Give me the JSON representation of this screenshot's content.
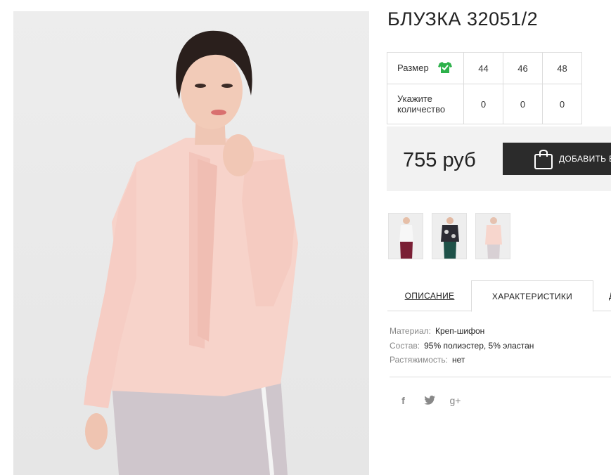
{
  "product": {
    "title": "БЛУЗКА 32051/2",
    "price": "755 руб",
    "add_to_cart_label": "ДОБАВИТЬ В КОРЗИНУ"
  },
  "sizes": {
    "size_label": "Размер",
    "size_icon": "shirt-check-icon",
    "qty_label": "Укажите количество",
    "columns": [
      "44",
      "46",
      "48"
    ],
    "quantities": [
      "0",
      "0",
      "0"
    ]
  },
  "thumbnails": [
    "thumb-white-blouse-burgundy-pants",
    "thumb-floral-blouse-green-pants",
    "thumb-pink-blouse"
  ],
  "tabs": [
    {
      "label": "ОПИСАНИЕ",
      "active": false
    },
    {
      "label": "ХАРАКТЕРИСТИКИ",
      "active": true
    },
    {
      "label": "Д",
      "active": false
    }
  ],
  "specs": [
    {
      "key": "Материал:",
      "value": "Креп-шифон"
    },
    {
      "key": "Состав:",
      "value": "95% полиэстер, 5% эластан"
    },
    {
      "key": "Растяжимость:",
      "value": "нет"
    }
  ],
  "share": {
    "facebook": "f",
    "twitter": "twitter-icon",
    "googleplus": "g+"
  },
  "colors": {
    "accent_green": "#2db14b",
    "button_dark": "#2b2b2b",
    "buy_box_bg": "#f2f2f2"
  }
}
